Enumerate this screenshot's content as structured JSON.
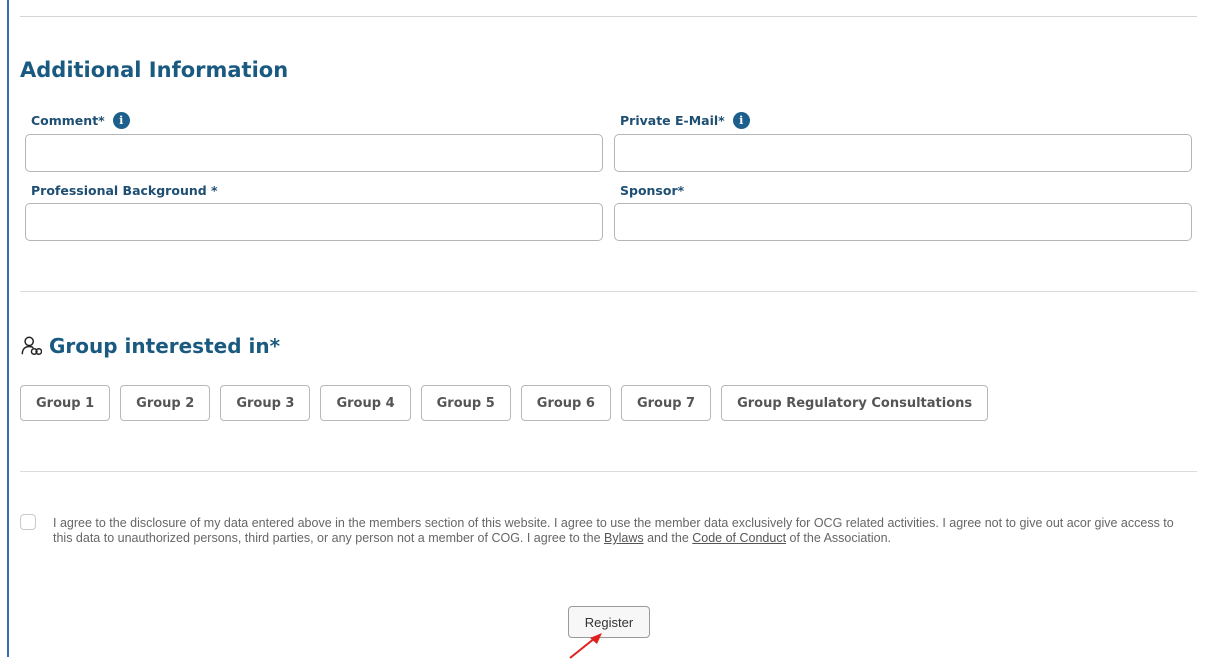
{
  "additional_info": {
    "title": "Additional Information",
    "comment_label": "Comment*",
    "private_email_label": "Private E-Mail*",
    "professional_background_label": "Professional Background *",
    "sponsor_label": "Sponsor*",
    "comment_value": "",
    "private_email_value": "",
    "professional_background_value": "",
    "sponsor_value": ""
  },
  "groups": {
    "heading": "Group interested in*",
    "items": [
      {
        "label": "Group 1"
      },
      {
        "label": "Group 2"
      },
      {
        "label": "Group 3"
      },
      {
        "label": "Group 4"
      },
      {
        "label": "Group 5"
      },
      {
        "label": "Group 6"
      },
      {
        "label": "Group 7"
      },
      {
        "label": "Group Regulatory Consultations"
      }
    ]
  },
  "consent": {
    "checked": false,
    "text_before": "I agree to the disclosure of my data entered above in the members section of this website. I agree to use the member data exclusively for OCG related activities. I agree not to give out acor give access to this data to unauthorized persons, third parties, or any person not a member of COG. I agree to the ",
    "bylaws_link": "Bylaws",
    "text_middle": " and the ",
    "code_link": "Code of Conduct",
    "text_after": " of the Association."
  },
  "register_label": "Register",
  "colors": {
    "heading": "#1a5a80",
    "label": "#1e4f72",
    "info_icon": "#1d5f8c",
    "frame": "#3a6fb0",
    "annotation_arrow": "#e02020"
  },
  "icons": {
    "info": "info-icon",
    "group": "people-icon"
  }
}
